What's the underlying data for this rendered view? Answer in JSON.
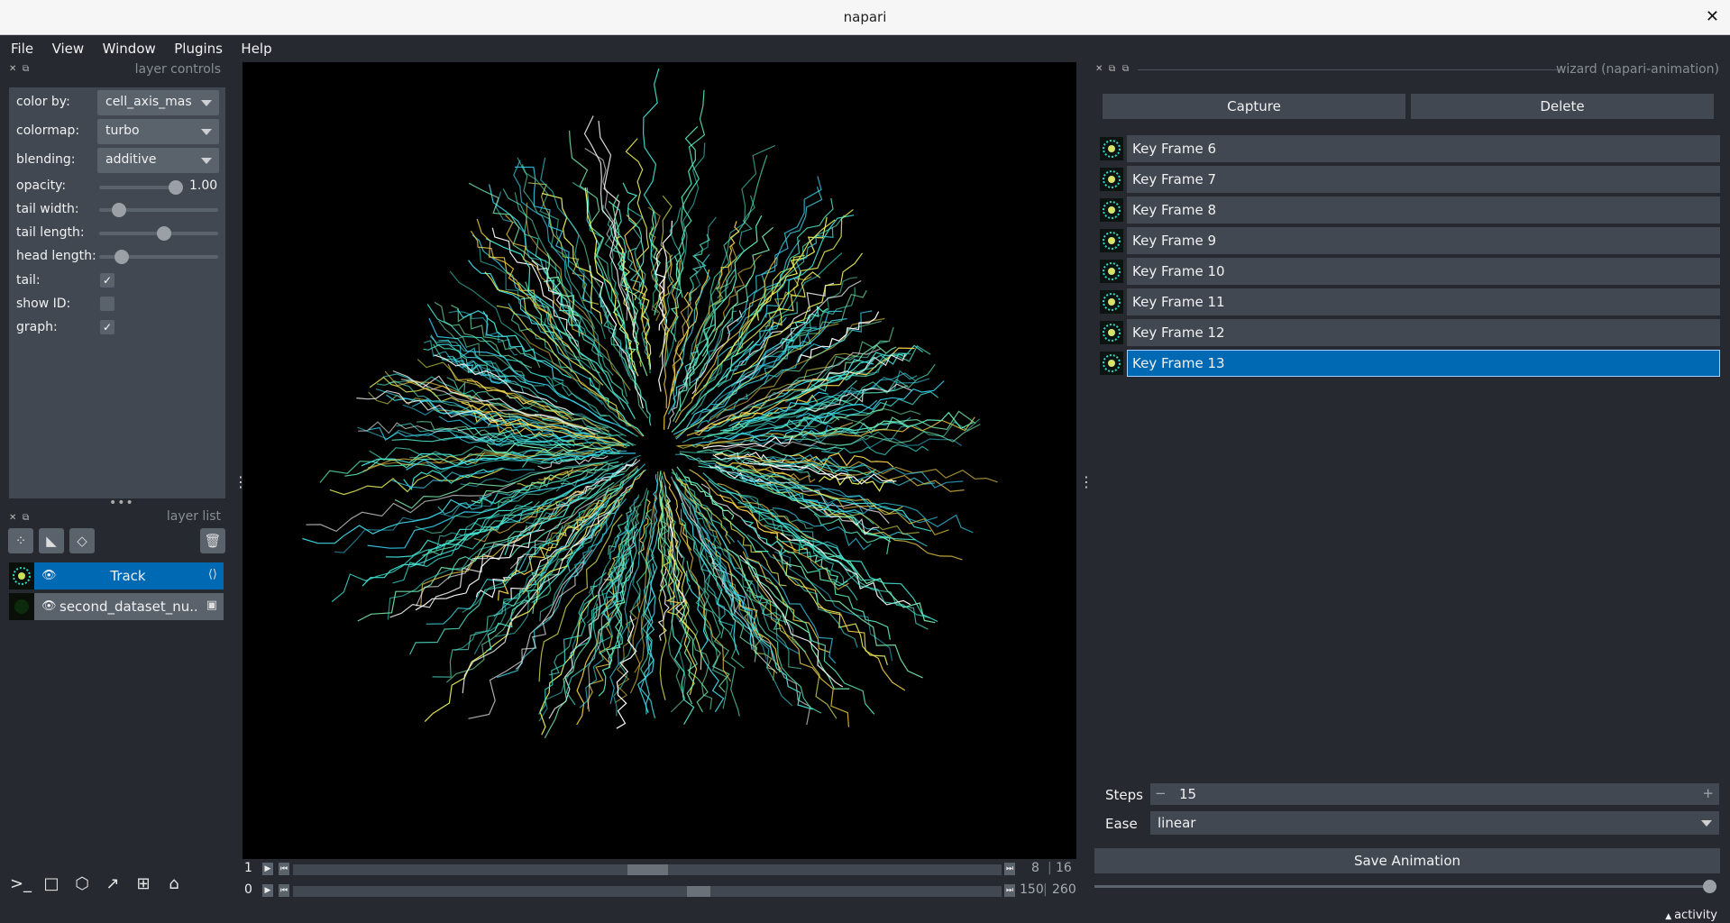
{
  "window": {
    "title": "napari",
    "close_glyph": "✕"
  },
  "menu": [
    "File",
    "View",
    "Window",
    "Plugins",
    "Help"
  ],
  "layer_controls": {
    "title": "layer controls",
    "color_by": {
      "label": "color by:",
      "value": "cell_axis_mas"
    },
    "colormap": {
      "label": "colormap:",
      "value": "turbo"
    },
    "blending": {
      "label": "blending:",
      "value": "additive"
    },
    "opacity": {
      "label": "opacity:",
      "value": "1.00",
      "level": 1.0
    },
    "tail_width": {
      "label": "tail width:",
      "level": 0.12
    },
    "tail_length": {
      "label": "tail length:",
      "level": 0.55
    },
    "head_length": {
      "label": "head length:",
      "level": 0.15
    },
    "tail": {
      "label": "tail:",
      "checked": true
    },
    "show_id": {
      "label": "show ID:",
      "checked": false
    },
    "graph": {
      "label": "graph:",
      "checked": true
    }
  },
  "layer_list": {
    "title": "layer list",
    "layers": [
      {
        "name": "Track",
        "selected": true,
        "type_icon": "tracks-icon"
      },
      {
        "name": "second_dataset_nu...",
        "selected": false,
        "type_icon": "image-icon"
      }
    ]
  },
  "dims": [
    {
      "axis": "1",
      "current": "8",
      "total": "16",
      "position": 0.5
    },
    {
      "axis": "0",
      "current": "150",
      "total": "260",
      "position": 0.575
    }
  ],
  "wizard": {
    "title": "wizard (napari-animation)",
    "capture_label": "Capture",
    "delete_label": "Delete",
    "key_frames": [
      "Key Frame 6",
      "Key Frame 7",
      "Key Frame 8",
      "Key Frame 9",
      "Key Frame 10",
      "Key Frame 11",
      "Key Frame 12",
      "Key Frame 13"
    ],
    "selected_index": 7,
    "steps_label": "Steps",
    "steps_value": "15",
    "ease_label": "Ease",
    "ease_value": "linear",
    "save_label": "Save Animation",
    "progress": 1.0
  },
  "status": {
    "activity": "activity"
  },
  "colors": {
    "background": "#262930",
    "panel": "#414851",
    "accent": "#0069b3"
  }
}
